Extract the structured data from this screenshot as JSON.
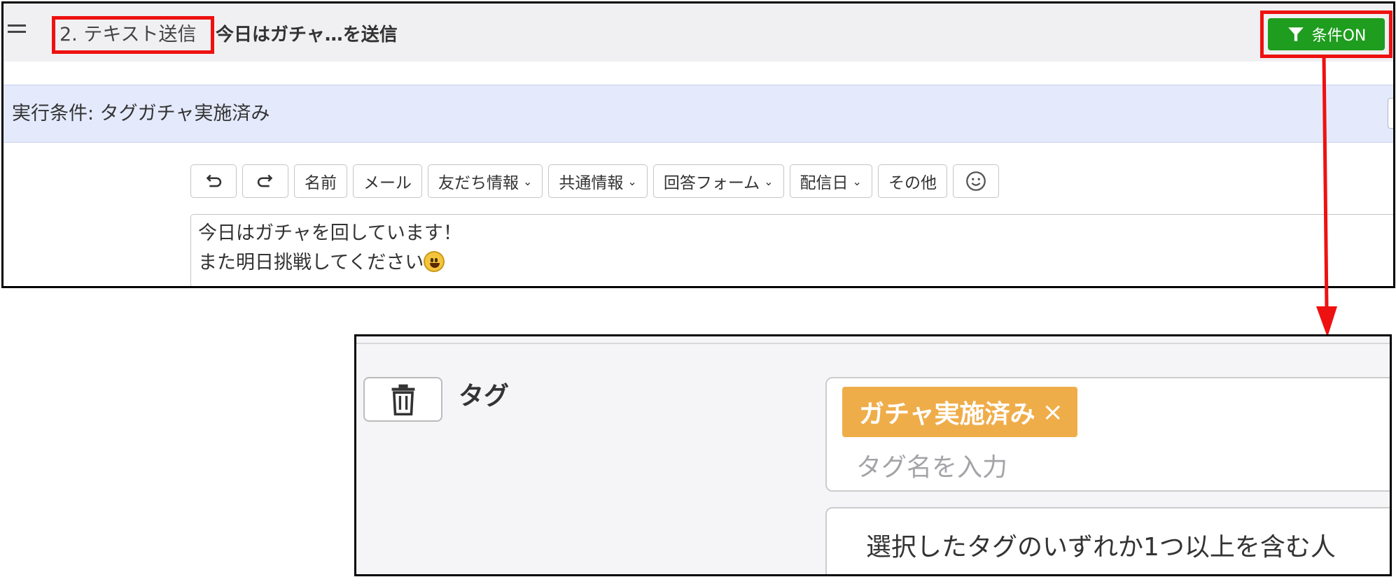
{
  "header": {
    "step_label": "2. テキスト送信",
    "step_title": "今日はガチャ…を送信",
    "condition_button_label": "条件ON"
  },
  "condition_bar": {
    "text": "実行条件: タグガチャ実施済み"
  },
  "toolbar": {
    "undo_icon": "undo-icon",
    "redo_icon": "redo-icon",
    "buttons": [
      {
        "label": "名前",
        "dropdown": false
      },
      {
        "label": "メール",
        "dropdown": false
      },
      {
        "label": "友だち情報",
        "dropdown": true
      },
      {
        "label": "共通情報",
        "dropdown": true
      },
      {
        "label": "回答フォーム",
        "dropdown": true
      },
      {
        "label": "配信日",
        "dropdown": true
      },
      {
        "label": "その他",
        "dropdown": false
      }
    ],
    "emoji_icon": "smiley-icon"
  },
  "message": {
    "line1": "今日はガチャを回しています！",
    "line2": "また明日挑戦してください"
  },
  "tag_condition": {
    "heading": "タグ",
    "chip_label": "ガチャ実施済み",
    "chip_remove": "×",
    "input_placeholder": "タグ名を入力",
    "match_mode": "選択したタグのいずれか1つ以上を含む人"
  },
  "colors": {
    "highlight_red": "#ee1111",
    "condition_green": "#1e9d1e",
    "condition_bar_bg": "#e4eafc",
    "tag_chip_orange": "#efad4a"
  }
}
